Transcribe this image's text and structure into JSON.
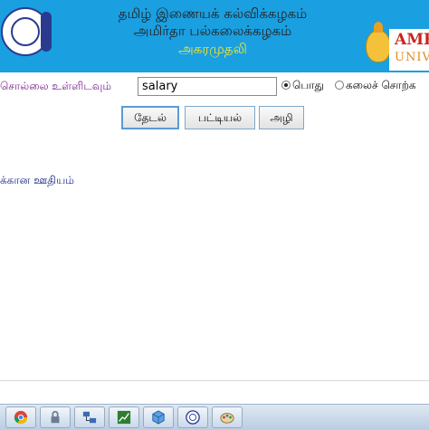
{
  "banner": {
    "title_line1": "தமிழ் இணையக் கல்விக்கழகம்",
    "title_line2": "அமிர்தா பல்கலைக்கழகம்",
    "title_line3": "அகரமுதலி",
    "brand_line1": "AMR",
    "brand_line2": "UNIV",
    "colors": {
      "banner_bg": "#1a9fe0",
      "subtitle": "#f5e62a",
      "brand_red": "#c8261e"
    }
  },
  "search": {
    "label": "சொல்லை உள்ளிடவும்",
    "value": "salary",
    "options": [
      {
        "label": "பொது",
        "selected": true
      },
      {
        "label": "கலைச் சொற்க",
        "selected": false
      }
    ]
  },
  "buttons": {
    "search": "தேடல்",
    "list": "பட்டியல்",
    "clear": "அழி"
  },
  "result": {
    "text": "க்கான ஊதியம்"
  },
  "taskbar": {
    "icons": [
      "chrome-icon",
      "lock-icon",
      "network-icon",
      "chart-icon",
      "cube-icon",
      "seal-icon",
      "paint-icon"
    ]
  }
}
